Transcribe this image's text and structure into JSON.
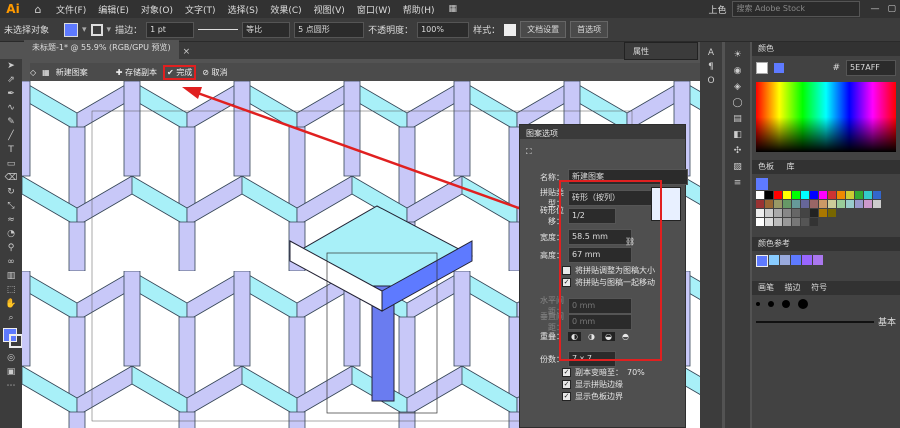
{
  "menubar": {
    "logo": "Ai",
    "items": [
      "文件(F)",
      "编辑(E)",
      "对象(O)",
      "文字(T)",
      "选择(S)",
      "效果(C)",
      "视图(V)",
      "窗口(W)",
      "帮助(H)"
    ],
    "workspace": "上色",
    "search_placeholder": "搜索 Adobe Stock"
  },
  "control_bar": {
    "selection_label": "未选择对象",
    "stroke_label": "描边：",
    "stroke_value": "1 pt",
    "line_style": "等比",
    "brush": "5 点圆形",
    "opacity_label": "不透明度：",
    "opacity_value": "100%",
    "style_label": "样式：",
    "doc_setup": "文档设置",
    "preferences": "首选项"
  },
  "document_tab": {
    "title": "未标题-1* @ 55.9% (RGB/GPU 预览)"
  },
  "attributes_panel": {
    "label": "属性"
  },
  "isolation_bar": {
    "new_pattern": "新建图案",
    "save_copy": "存储副本",
    "done": "完成",
    "cancel": "取消"
  },
  "pattern_dialog": {
    "title": "图案选项",
    "name_label": "名称：",
    "name_value": "新建图案",
    "tile_type_label": "拼贴类型：",
    "tile_type_value": "砖形（按列）",
    "brick_offset_label": "砖形位移：",
    "brick_offset_value": "1/2",
    "width_label": "宽度：",
    "width_value": "58.5 mm",
    "height_label": "高度：",
    "height_value": "67 mm",
    "opt_resize": "将拼贴调整为图稿大小",
    "opt_move": "将拼贴与图稿一起移动",
    "h_spacing_label": "水平间距：",
    "h_spacing_value": "0 mm",
    "v_spacing_label": "垂直间距：",
    "v_spacing_value": "0 mm",
    "overlap_label": "重叠：",
    "copies_label": "份数：",
    "copies_value": "7 x 7",
    "dim_copies": "副本变暗至：",
    "dim_value": "70%",
    "show_tile_edge": "显示拼贴边缘",
    "show_swatch_bounds": "显示色板边界"
  },
  "color_panel": {
    "title": "颜色",
    "hex": "5E7AFF"
  },
  "swatches_panel": {
    "tabs": [
      "色板",
      "库"
    ]
  },
  "color_guide_panel": {
    "title": "颜色参考"
  },
  "brush_panel": {
    "tabs": [
      "画笔",
      "描边",
      "符号"
    ],
    "basic_label": "基本"
  },
  "colors": {
    "accent": "#5E7AFF",
    "cube_light": "#a8f0f8",
    "cube_mid": "#c8c8f8",
    "cube_dark": "#8890f0",
    "highlight_red": "#e02020"
  }
}
